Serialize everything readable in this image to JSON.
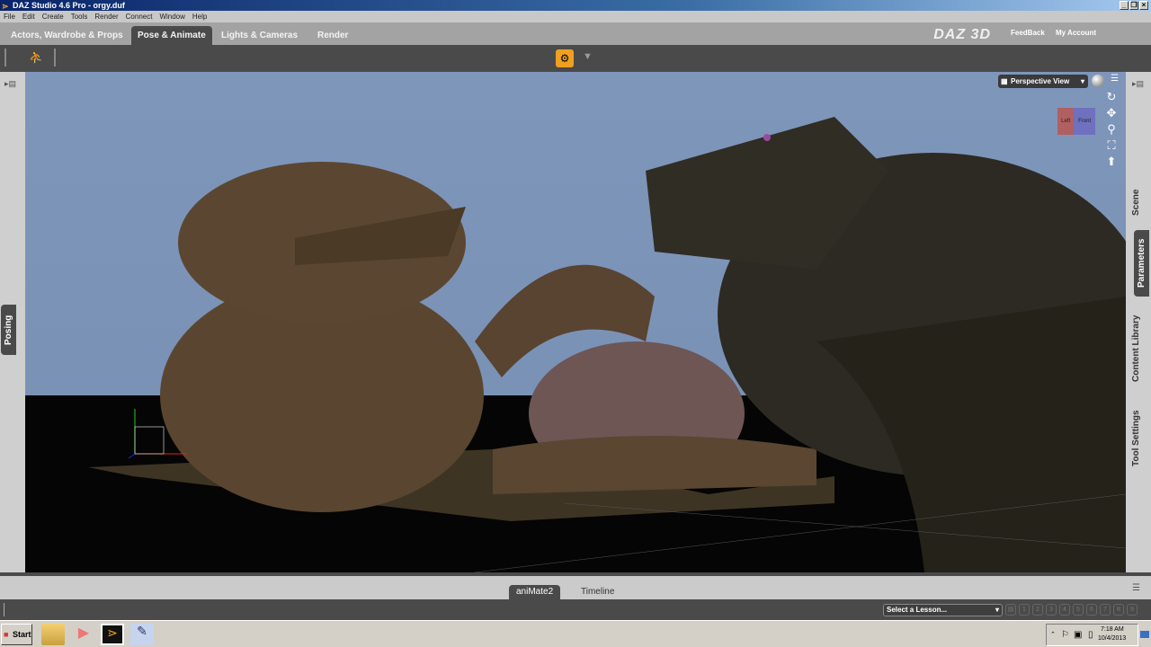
{
  "window": {
    "title": "DAZ Studio 4.6 Pro - orgy.duf",
    "min": "_",
    "max": "❐",
    "close": "×"
  },
  "menu": [
    "File",
    "Edit",
    "Create",
    "Tools",
    "Render",
    "Connect",
    "Window",
    "Help"
  ],
  "tabs": [
    {
      "label": "Actors, Wardrobe & Props"
    },
    {
      "label": "Pose & Animate"
    },
    {
      "label": "Lights & Cameras"
    },
    {
      "label": "Render"
    }
  ],
  "header": {
    "logo": "DAZ 3D",
    "feedback": "FeedBack",
    "account": "My Account"
  },
  "viewport": {
    "view": "Perspective View",
    "cube_left": "Left",
    "cube_front": "Front"
  },
  "left_panel": {
    "tab": "Posing"
  },
  "right_panel": {
    "tabs": [
      "Scene",
      "Parameters",
      "Content Library",
      "Tool Settings"
    ]
  },
  "bottom_tabs": [
    "aniMate2",
    "Timeline"
  ],
  "lesson": {
    "select": "Select a Lesson...",
    "pages": [
      "1",
      "2",
      "3",
      "4",
      "5",
      "6",
      "7",
      "8",
      "9"
    ]
  },
  "taskbar": {
    "start": "Start",
    "time": "7:18 AM",
    "date": "10/4/2013"
  },
  "colors": {
    "accent": "#f0a020",
    "sky": "#7f96bb",
    "panel": "#4a4a4a"
  }
}
